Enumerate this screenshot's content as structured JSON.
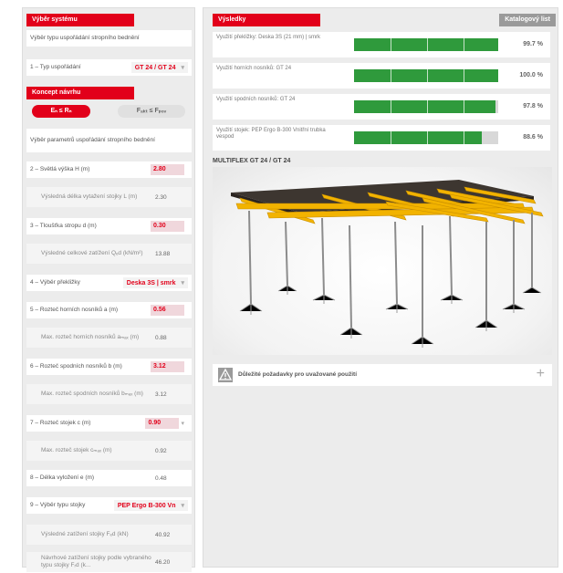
{
  "left": {
    "system_header": "Výběr systému",
    "system_desc": "Výběr typu uspořádání stropního bednění",
    "layout_type": {
      "label": "1 – Typ uspořádání",
      "value": "GT 24 / GT 24"
    },
    "concept_header": "Koncept návrhu",
    "concept_left": "Eₙ ≤ Rₙ",
    "concept_right": "Fₐₖₜ ≤ Fₚₒᵥ",
    "params_desc": "Výběr parametrů uspořádání stropního bednění",
    "rows": [
      {
        "label": "2 – Světlá výška H (m)",
        "value": "2.80",
        "style": "red"
      },
      {
        "label": "Výsledná délka vytažení stojky L (m)",
        "value": "2.30",
        "style": "sub"
      },
      {
        "label": "3 – Tloušťka stropu d (m)",
        "value": "0.30",
        "style": "red"
      },
      {
        "label": "Výsledné celkové zatížení Qₑd (kN/m²)",
        "value": "13.88",
        "style": "sub"
      },
      {
        "label": "4 – Výběr překližky",
        "value": "Deska 3S | smrk",
        "style": "select"
      },
      {
        "label": "5 – Rozteč horních nosníků a (m)",
        "value": "0.56",
        "style": "red"
      },
      {
        "label": "Max. rozteč horních nosníků aₘₐₓ (m)",
        "value": "0.88",
        "style": "sub"
      },
      {
        "label": "6 – Rozteč spodních nosníků b (m)",
        "value": "3.12",
        "style": "red"
      },
      {
        "label": "Max. rozteč spodních nosníků bₘₐₓ (m)",
        "value": "3.12",
        "style": "sub"
      },
      {
        "label": "7 – Rozteč stojek c (m)",
        "value": "0.90",
        "style": "redsel"
      },
      {
        "label": "Max. rozteč stojek cₘₐₓ (m)",
        "value": "0.92",
        "style": "sub"
      },
      {
        "label": "8 – Délka vyložení e (m)",
        "value": "0.48",
        "style": "plain"
      },
      {
        "label": "9 – Výběr typu stojky",
        "value": "PEP Ergo B-300 Vn",
        "style": "select"
      },
      {
        "label": "Výsledné zatížení stojky Fₑd (kN)",
        "value": "40.92",
        "style": "sub"
      },
      {
        "label": "Návrhové zatížení stojky podle vybraného typu stojky Fᵣd (k...",
        "value": "46.20",
        "style": "sub"
      }
    ]
  },
  "right": {
    "results_header": "Výsledky",
    "catalog_button": "Katalogový list",
    "results": [
      {
        "label": "Využití překližky: Deska 3S (21 mm) | smrk",
        "percent": "99.7 %",
        "fill": 0.997
      },
      {
        "label": "Využití horních nosníků: GT 24",
        "percent": "100.0 %",
        "fill": 1.0
      },
      {
        "label": "Využití spodních nosníků: GT 24",
        "percent": "97.8 %",
        "fill": 0.978
      },
      {
        "label": "Využití stojek: PEP Ergo B-300 Vnitřní trubka vespod",
        "percent": "88.6 %",
        "fill": 0.886
      }
    ],
    "diagram_title": "MULTIFLEX GT 24 / GT 24",
    "requirements_label": "Důležité požadavky pro uvažované použití",
    "plus_icon": "plus-icon",
    "warning_icon": "warning-icon"
  },
  "colors": {
    "accent": "#e2001a",
    "bar": "#2f9a3c",
    "beam": "#f2b300"
  }
}
